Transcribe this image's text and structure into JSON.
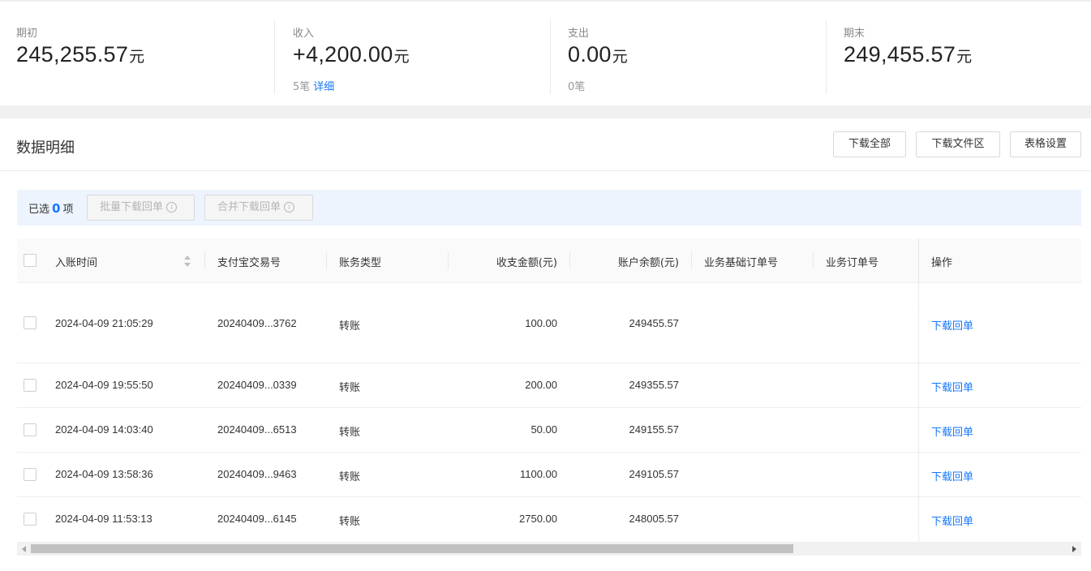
{
  "summary": {
    "opening": {
      "label": "期初",
      "value": "245,255.57",
      "unit": "元"
    },
    "income": {
      "label": "收入",
      "value": "+4,200.00",
      "unit": "元",
      "count": "5笔",
      "detail_link": "详细"
    },
    "expense": {
      "label": "支出",
      "value": "0.00",
      "unit": "元",
      "count": "0笔"
    },
    "closing": {
      "label": "期末",
      "value": "249,455.57",
      "unit": "元"
    }
  },
  "panel": {
    "title": "数据明细",
    "buttons": {
      "download_all": "下载全部",
      "download_area": "下载文件区",
      "table_settings": "表格设置"
    }
  },
  "selection": {
    "prefix": "已选",
    "count": "0",
    "suffix": "项",
    "batch_download": "批量下载回单",
    "merge_download": "合并下载回单"
  },
  "table": {
    "columns": {
      "time": "入账时间",
      "trade_no": "支付宝交易号",
      "type": "账务类型",
      "amount": "收支金额(元)",
      "balance": "账户余额(元)",
      "base_order": "业务基础订单号",
      "order": "业务订单号",
      "action": "操作"
    },
    "rows": [
      {
        "time": "2024-04-09 21:05:29",
        "trade_no": "20240409...3762",
        "type": "转账",
        "amount": "100.00",
        "balance": "249455.57",
        "action": "下载回单"
      },
      {
        "time": "2024-04-09 19:55:50",
        "trade_no": "20240409...0339",
        "type": "转账",
        "amount": "200.00",
        "balance": "249355.57",
        "action": "下载回单"
      },
      {
        "time": "2024-04-09 14:03:40",
        "trade_no": "20240409...6513",
        "type": "转账",
        "amount": "50.00",
        "balance": "249155.57",
        "action": "下载回单"
      },
      {
        "time": "2024-04-09 13:58:36",
        "trade_no": "20240409...9463",
        "type": "转账",
        "amount": "1100.00",
        "balance": "249105.57",
        "action": "下载回单"
      },
      {
        "time": "2024-04-09 11:53:13",
        "trade_no": "20240409...6145",
        "type": "转账",
        "amount": "2750.00",
        "balance": "248005.57",
        "action": "下载回单"
      }
    ]
  },
  "colors": {
    "accent": "#1677ff",
    "select_bar": "#edf4fe"
  }
}
